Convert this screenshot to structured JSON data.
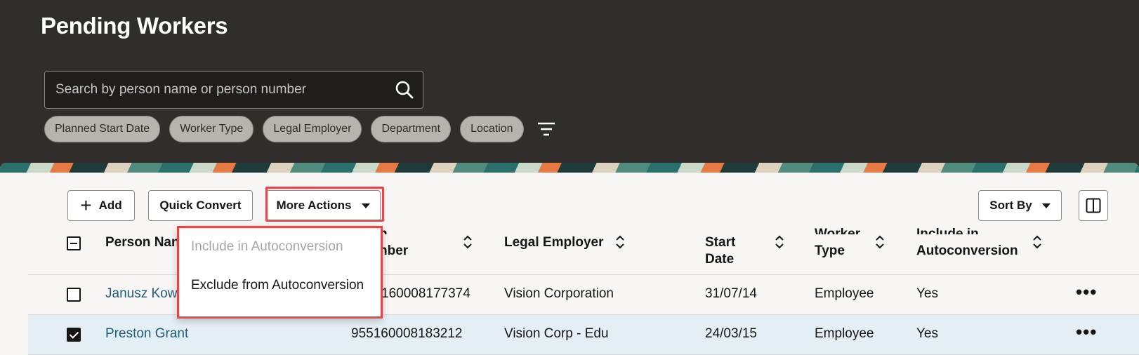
{
  "header": {
    "title": "Pending Workers",
    "search": {
      "placeholder": "Search by person name or person number",
      "value": ""
    },
    "filters": [
      "Planned Start Date",
      "Worker Type",
      "Legal Employer",
      "Department",
      "Location"
    ]
  },
  "toolbar": {
    "add_label": "Add",
    "quick_convert_label": "Quick Convert",
    "more_actions_label": "More Actions",
    "sort_label": "Sort By"
  },
  "table": {
    "columns": {
      "person_name": "Person Nan",
      "person_number_line1": "n",
      "person_number_line2": "nber",
      "legal_employer": "Legal Employer",
      "start_date_line1": "Start",
      "start_date_line2": "Date",
      "worker_type_line1": "Worker",
      "worker_type_line2": "Type",
      "autoconv_line1": "Include in",
      "autoconv_line2": "Autoconversion"
    },
    "rows": [
      {
        "name": "Janusz Kow",
        "number": "160008177374",
        "employer": "Vision Corporation",
        "start": "31/07/14",
        "type": "Employee",
        "autoconv": "Yes",
        "checked": false
      },
      {
        "name": "Preston Grant",
        "number": "955160008183212",
        "employer": "Vision Corp - Edu",
        "start": "24/03/15",
        "type": "Employee",
        "autoconv": "Yes",
        "checked": true
      }
    ],
    "more_glyph": "•••"
  },
  "menu": {
    "items": [
      {
        "label": "Include in Autoconversion",
        "disabled": true
      },
      {
        "label": "Exclude from Autoconversion",
        "disabled": false
      }
    ]
  },
  "colors": {
    "header_bg": "#312d2a",
    "highlight": "#e24848",
    "link": "#1f5c7a",
    "selected_row": "#e4eff5"
  }
}
